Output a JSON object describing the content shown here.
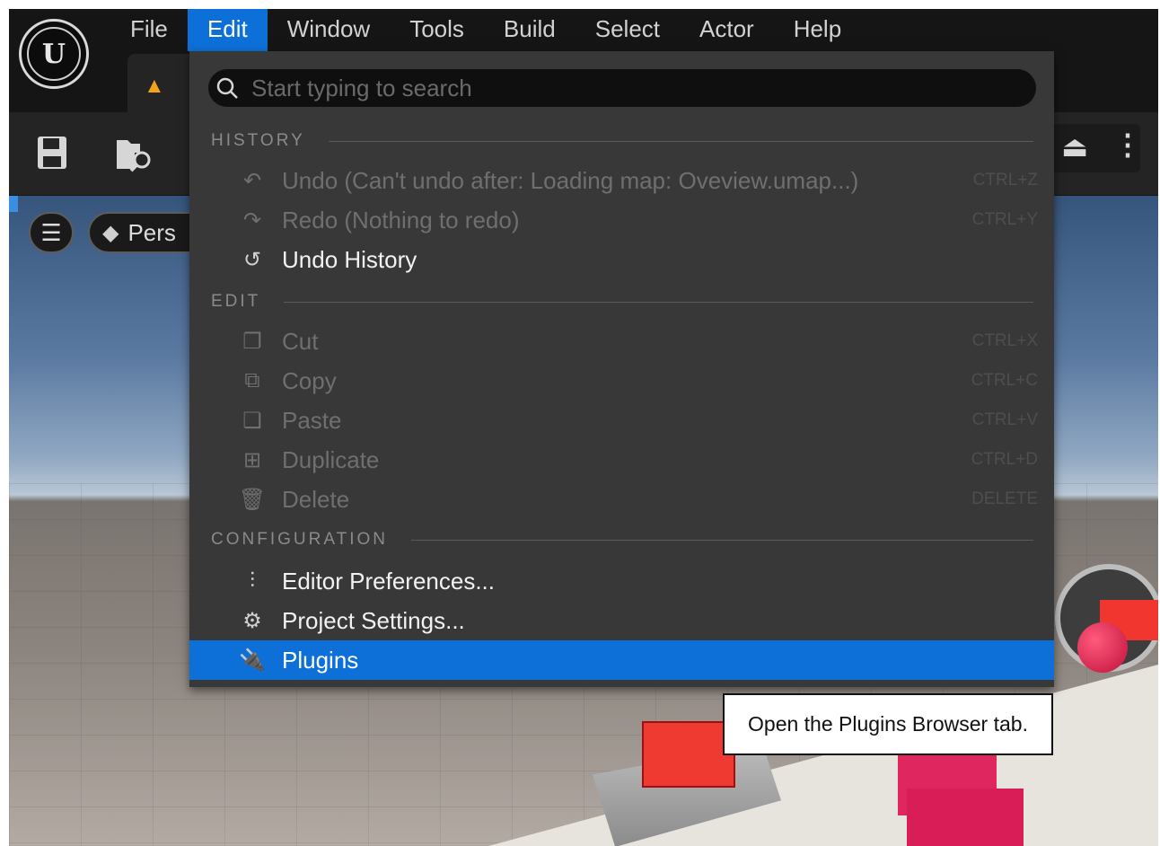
{
  "menubar": {
    "items": [
      {
        "label": "File"
      },
      {
        "label": "Edit"
      },
      {
        "label": "Window"
      },
      {
        "label": "Tools"
      },
      {
        "label": "Build"
      },
      {
        "label": "Select"
      },
      {
        "label": "Actor"
      },
      {
        "label": "Help"
      }
    ],
    "active": "Edit"
  },
  "logo": {
    "glyph": "U"
  },
  "viewport": {
    "perspective_label": "Pers"
  },
  "dropdown": {
    "search_placeholder": "Start typing to search",
    "sections": {
      "history": "HISTORY",
      "edit": "EDIT",
      "configuration": "CONFIGURATION"
    },
    "history_items": [
      {
        "label": "Undo (Can't undo after: Loading map: Oveview.umap...)",
        "shortcut": "CTRL+Z",
        "icon": "undo-icon"
      },
      {
        "label": "Redo (Nothing to redo)",
        "shortcut": "CTRL+Y",
        "icon": "redo-icon"
      },
      {
        "label": "Undo History",
        "shortcut": "",
        "icon": "undo-history-icon"
      }
    ],
    "edit_items": [
      {
        "label": "Cut",
        "shortcut": "CTRL+X",
        "icon": "cut-icon"
      },
      {
        "label": "Copy",
        "shortcut": "CTRL+C",
        "icon": "copy-icon"
      },
      {
        "label": "Paste",
        "shortcut": "CTRL+V",
        "icon": "paste-icon"
      },
      {
        "label": "Duplicate",
        "shortcut": "CTRL+D",
        "icon": "duplicate-icon"
      },
      {
        "label": "Delete",
        "shortcut": "DELETE",
        "icon": "trash-icon"
      }
    ],
    "configuration_items": [
      {
        "label": "Editor Preferences...",
        "icon": "sliders-icon"
      },
      {
        "label": "Project Settings...",
        "icon": "project-settings-icon"
      },
      {
        "label": "Plugins",
        "icon": "plugin-icon"
      }
    ]
  },
  "tooltip": {
    "text": "Open the Plugins Browser tab."
  },
  "colors": {
    "accent": "#0c70d8",
    "menu_bg": "#383838",
    "warning": "#f2a21b"
  }
}
